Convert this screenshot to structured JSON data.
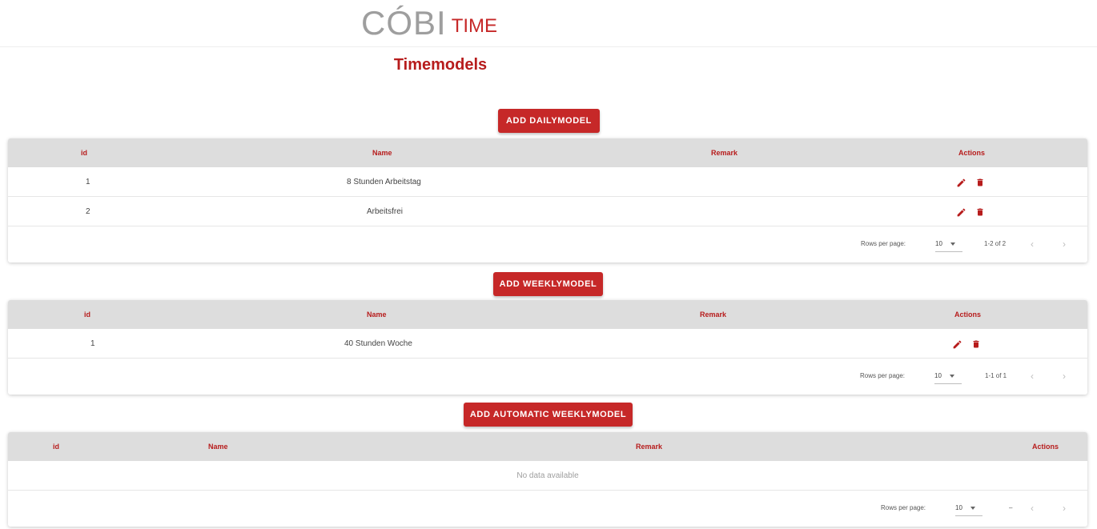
{
  "logo": {
    "main": "CÓBI",
    "suffix": "TIME"
  },
  "page_title": "Timemodels",
  "daily": {
    "add_button": "ADD DAILYMODEL",
    "headers": {
      "id": "id",
      "name": "Name",
      "remark": "Remark",
      "actions": "Actions"
    },
    "rows": [
      {
        "id": "1",
        "name": "8 Stunden Arbeitstag",
        "remark": ""
      },
      {
        "id": "2",
        "name": "Arbeitsfrei",
        "remark": ""
      }
    ],
    "footer": {
      "rows_per_page_label": "Rows per page:",
      "rows_per_page_value": "10",
      "range": "1-2 of 2",
      "prev": "‹",
      "next": "›"
    }
  },
  "weekly": {
    "add_button": "ADD WEEKLYMODEL",
    "headers": {
      "id": "id",
      "name": "Name",
      "remark": "Remark",
      "actions": "Actions"
    },
    "rows": [
      {
        "id": "1",
        "name": "40 Stunden Woche",
        "remark": ""
      }
    ],
    "footer": {
      "rows_per_page_label": "Rows per page:",
      "rows_per_page_value": "10",
      "range": "1-1 of 1",
      "prev": "‹",
      "next": "›"
    }
  },
  "automatic": {
    "add_button": "ADD AUTOMATIC WEEKLYMODEL",
    "headers": {
      "id": "id",
      "name": "Name",
      "remark": "Remark",
      "actions": "Actions"
    },
    "no_data": "No data available",
    "footer": {
      "rows_per_page_label": "Rows per page:",
      "rows_per_page_value": "10",
      "range": "–",
      "prev": "‹",
      "next": "›"
    }
  },
  "icons": {
    "edit": "pencil-icon",
    "delete": "trash-icon"
  },
  "colors": {
    "accent": "#c62828",
    "header_bg": "#dddddd",
    "title": "#b71c1c"
  }
}
